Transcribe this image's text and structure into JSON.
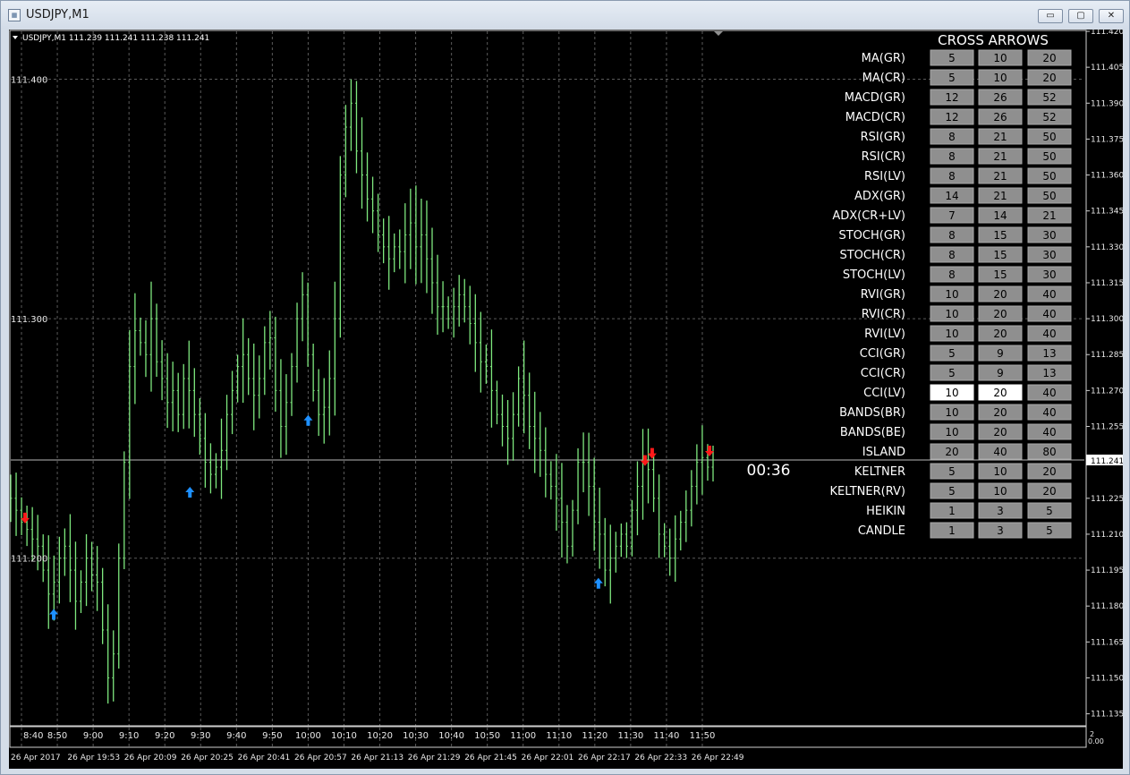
{
  "window": {
    "title": "USDJPY,M1",
    "buttons": {
      "minimize": "▭",
      "restore": "▢",
      "close": "✕"
    }
  },
  "chart": {
    "header": "USDJPY,M1  111.239 111.241 111.238 111.241",
    "left_price_labels": [
      "111.400",
      "111.300",
      "111.200"
    ],
    "price_ticks": [
      "111.420",
      "111.405",
      "111.390",
      "111.375",
      "111.360",
      "111.345",
      "111.330",
      "111.315",
      "111.300",
      "111.285",
      "111.270",
      "111.255",
      "111.240",
      "111.225",
      "111.210",
      "111.195",
      "111.180",
      "111.165",
      "111.150",
      "111.135"
    ],
    "current_price": "111.241",
    "time_ticks": [
      "8:40",
      "8:50",
      "9:00",
      "9:10",
      "9:20",
      "9:30",
      "9:40",
      "9:50",
      "10:00",
      "10:10",
      "10:20",
      "10:30",
      "10:40",
      "10:50",
      "11:00",
      "11:10",
      "11:20",
      "11:30",
      "11:40",
      "11:50"
    ],
    "date_ticks": [
      "26 Apr 2017",
      "26 Apr 19:53",
      "26 Apr 20:09",
      "26 Apr 20:25",
      "26 Apr 20:41",
      "26 Apr 20:57",
      "26 Apr 21:13",
      "26 Apr 21:29",
      "26 Apr 21:45",
      "26 Apr 22:01",
      "26 Apr 22:17",
      "26 Apr 22:33",
      "26 Apr 22:49"
    ],
    "sub_scale": [
      "2",
      "0.00"
    ],
    "countdown": "00:36",
    "colors": {
      "background": "#000000",
      "candles": "#7ee87e",
      "grid": "#5a5a5a",
      "arrow_up": "#1e90ff",
      "arrow_down": "#ff1a1a"
    }
  },
  "chart_data": {
    "type": "line",
    "series": [
      {
        "values": [
          111.225,
          111.22,
          111.215,
          111.212,
          111.208,
          111.205,
          111.195,
          111.185,
          111.19,
          111.2,
          111.205,
          111.195,
          111.182,
          111.19,
          111.2,
          111.193,
          111.19,
          111.17,
          111.15,
          111.16,
          111.2,
          111.24,
          111.28,
          111.295,
          111.29,
          111.285,
          111.3,
          111.282,
          111.275,
          111.265,
          111.27,
          111.26,
          111.275,
          111.27,
          111.26,
          111.25,
          111.24,
          111.235,
          111.238,
          111.245,
          111.26,
          111.27,
          111.28,
          111.285,
          111.275,
          111.268,
          111.275,
          111.29,
          111.292,
          111.27,
          111.255,
          111.265,
          111.28,
          111.3,
          111.31,
          111.285,
          111.27,
          111.26,
          111.263,
          111.275,
          111.3,
          111.36,
          111.38,
          111.39,
          111.37,
          111.36,
          111.35,
          111.345,
          111.335,
          111.33,
          111.325,
          111.33,
          111.328,
          111.335,
          111.34,
          111.33,
          111.335,
          111.325,
          111.315,
          111.305,
          111.305,
          111.3,
          111.305,
          111.31,
          111.305,
          111.298,
          111.29,
          111.282,
          111.28,
          111.27,
          111.26,
          111.255,
          111.25,
          111.26,
          111.275,
          111.268,
          111.255,
          111.25,
          111.245,
          111.235,
          111.23,
          111.225,
          111.215,
          111.205,
          111.22,
          111.24,
          111.24,
          111.23,
          111.215,
          111.21,
          111.195,
          111.2,
          111.205,
          111.21,
          111.205,
          111.22,
          111.23,
          111.24,
          111.237,
          111.225,
          111.21,
          111.205,
          111.2,
          111.208,
          111.215,
          111.22,
          111.23,
          111.24,
          111.242,
          111.238,
          111.241
        ]
      }
    ],
    "x_range": [
      "8:37",
      "11:53"
    ],
    "ylim": [
      111.13,
      111.42
    ],
    "grid": true,
    "signals": [
      {
        "time": "8:41",
        "direction": "down",
        "price": 111.213
      },
      {
        "time": "8:49",
        "direction": "up",
        "price": 111.181
      },
      {
        "time": "9:27",
        "direction": "up",
        "price": 111.232
      },
      {
        "time": "10:00",
        "direction": "up",
        "price": 111.262
      },
      {
        "time": "11:21",
        "direction": "up",
        "price": 111.194
      },
      {
        "time": "11:34",
        "direction": "down",
        "price": 111.237
      },
      {
        "time": "11:36",
        "direction": "down",
        "price": 111.24
      },
      {
        "time": "11:52",
        "direction": "down",
        "price": 111.241
      }
    ]
  },
  "panel": {
    "title": "CROSS ARROWS",
    "rows": [
      {
        "label": "MA(GR)",
        "values": [
          "5",
          "10",
          "20"
        ],
        "hl": [
          false,
          false,
          false
        ]
      },
      {
        "label": "MA(CR)",
        "values": [
          "5",
          "10",
          "20"
        ],
        "hl": [
          false,
          false,
          false
        ]
      },
      {
        "label": "MACD(GR)",
        "values": [
          "12",
          "26",
          "52"
        ],
        "hl": [
          false,
          false,
          false
        ]
      },
      {
        "label": "MACD(CR)",
        "values": [
          "12",
          "26",
          "52"
        ],
        "hl": [
          false,
          false,
          false
        ]
      },
      {
        "label": "RSI(GR)",
        "values": [
          "8",
          "21",
          "50"
        ],
        "hl": [
          false,
          false,
          false
        ]
      },
      {
        "label": "RSI(CR)",
        "values": [
          "8",
          "21",
          "50"
        ],
        "hl": [
          false,
          false,
          false
        ]
      },
      {
        "label": "RSI(LV)",
        "values": [
          "8",
          "21",
          "50"
        ],
        "hl": [
          false,
          false,
          false
        ]
      },
      {
        "label": "ADX(GR)",
        "values": [
          "14",
          "21",
          "50"
        ],
        "hl": [
          false,
          false,
          false
        ]
      },
      {
        "label": "ADX(CR+LV)",
        "values": [
          "7",
          "14",
          "21"
        ],
        "hl": [
          false,
          false,
          false
        ]
      },
      {
        "label": "STOCH(GR)",
        "values": [
          "8",
          "15",
          "30"
        ],
        "hl": [
          false,
          false,
          false
        ]
      },
      {
        "label": "STOCH(CR)",
        "values": [
          "8",
          "15",
          "30"
        ],
        "hl": [
          false,
          false,
          false
        ]
      },
      {
        "label": "STOCH(LV)",
        "values": [
          "8",
          "15",
          "30"
        ],
        "hl": [
          false,
          false,
          false
        ]
      },
      {
        "label": "RVI(GR)",
        "values": [
          "10",
          "20",
          "40"
        ],
        "hl": [
          false,
          false,
          false
        ]
      },
      {
        "label": "RVI(CR)",
        "values": [
          "10",
          "20",
          "40"
        ],
        "hl": [
          false,
          false,
          false
        ]
      },
      {
        "label": "RVI(LV)",
        "values": [
          "10",
          "20",
          "40"
        ],
        "hl": [
          false,
          false,
          false
        ]
      },
      {
        "label": "CCI(GR)",
        "values": [
          "5",
          "9",
          "13"
        ],
        "hl": [
          false,
          false,
          false
        ]
      },
      {
        "label": "CCI(CR)",
        "values": [
          "5",
          "9",
          "13"
        ],
        "hl": [
          false,
          false,
          false
        ]
      },
      {
        "label": "CCI(LV)",
        "values": [
          "10",
          "20",
          "40"
        ],
        "hl": [
          true,
          true,
          false
        ]
      },
      {
        "label": "BANDS(BR)",
        "values": [
          "10",
          "20",
          "40"
        ],
        "hl": [
          false,
          false,
          false
        ]
      },
      {
        "label": "BANDS(BE)",
        "values": [
          "10",
          "20",
          "40"
        ],
        "hl": [
          false,
          false,
          false
        ]
      },
      {
        "label": "ISLAND",
        "values": [
          "20",
          "40",
          "80"
        ],
        "hl": [
          false,
          false,
          false
        ]
      },
      {
        "label": "KELTNER",
        "values": [
          "5",
          "10",
          "20"
        ],
        "hl": [
          false,
          false,
          false
        ]
      },
      {
        "label": "KELTNER(RV)",
        "values": [
          "5",
          "10",
          "20"
        ],
        "hl": [
          false,
          false,
          false
        ]
      },
      {
        "label": "HEIKIN",
        "values": [
          "1",
          "3",
          "5"
        ],
        "hl": [
          false,
          false,
          false
        ]
      },
      {
        "label": "CANDLE",
        "values": [
          "1",
          "3",
          "5"
        ],
        "hl": [
          false,
          false,
          false
        ]
      }
    ]
  }
}
